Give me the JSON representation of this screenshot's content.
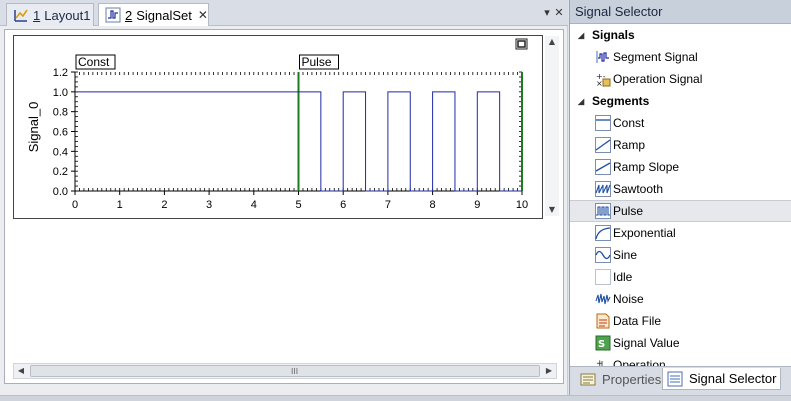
{
  "tabs": [
    {
      "number": "1",
      "label": "Layout1",
      "icon": "layout-icon",
      "active": false
    },
    {
      "number": "2",
      "label": "SignalSet",
      "icon": "signal-icon",
      "active": true,
      "close": "✕"
    }
  ],
  "strip_controls": {
    "dropdown": "▾",
    "close": "✕"
  },
  "chart_data": {
    "type": "line",
    "ylabel": "Signal_0",
    "xlabel": "",
    "xlim": [
      0,
      10
    ],
    "ylim": [
      0,
      1.2
    ],
    "x_ticks": [
      "0",
      "1",
      "2",
      "3",
      "4",
      "5",
      "6",
      "7",
      "8",
      "9",
      "10"
    ],
    "y_ticks": [
      "0.0",
      "0.2",
      "0.4",
      "0.6",
      "0.8",
      "1.0",
      "1.2"
    ],
    "segments": [
      {
        "label": "Const",
        "start": 0
      },
      {
        "label": "Pulse",
        "start": 5
      }
    ],
    "series": [
      {
        "color": "#1f2aa5",
        "x": [
          0,
          5.5,
          5.5,
          6,
          6,
          6.5,
          6.5,
          7,
          7,
          7.5,
          7.5,
          8,
          8,
          8.5,
          8.5,
          9,
          9,
          9.5,
          9.5,
          10
        ],
        "y": [
          1,
          1,
          0,
          0,
          1,
          1,
          0,
          0,
          1,
          1,
          0,
          0,
          1,
          1,
          0,
          0,
          1,
          1,
          0,
          0
        ]
      }
    ],
    "markers": [
      {
        "x": 5,
        "color": "#1e7a1e"
      },
      {
        "x": 10,
        "color": "#1e7a1e"
      }
    ],
    "grid": false
  },
  "scrollbar": {
    "grip": "III"
  },
  "right_panel": {
    "title": "Signal Selector",
    "groups": [
      {
        "label": "Signals",
        "items": [
          {
            "label": "Segment Signal",
            "icon": "segment-signal-icon"
          },
          {
            "label": "Operation Signal",
            "icon": "operation-signal-icon"
          }
        ]
      },
      {
        "label": "Segments",
        "items": [
          {
            "label": "Const",
            "icon": "const-icon"
          },
          {
            "label": "Ramp",
            "icon": "ramp-icon"
          },
          {
            "label": "Ramp Slope",
            "icon": "ramp-slope-icon"
          },
          {
            "label": "Sawtooth",
            "icon": "sawtooth-icon"
          },
          {
            "label": "Pulse",
            "icon": "pulse-icon",
            "selected": true
          },
          {
            "label": "Exponential",
            "icon": "exponential-icon"
          },
          {
            "label": "Sine",
            "icon": "sine-icon"
          },
          {
            "label": "Idle",
            "icon": "idle-icon"
          },
          {
            "label": "Noise",
            "icon": "noise-icon"
          },
          {
            "label": "Data File",
            "icon": "data-file-icon"
          },
          {
            "label": "Signal Value",
            "icon": "signal-value-icon"
          },
          {
            "label": "Operation",
            "icon": "operation-icon"
          }
        ]
      }
    ],
    "bottom_tabs": [
      {
        "label": "Properties",
        "icon": "properties-icon",
        "active": false
      },
      {
        "label": "Signal Selector",
        "icon": "signal-selector-icon",
        "active": true
      }
    ]
  }
}
